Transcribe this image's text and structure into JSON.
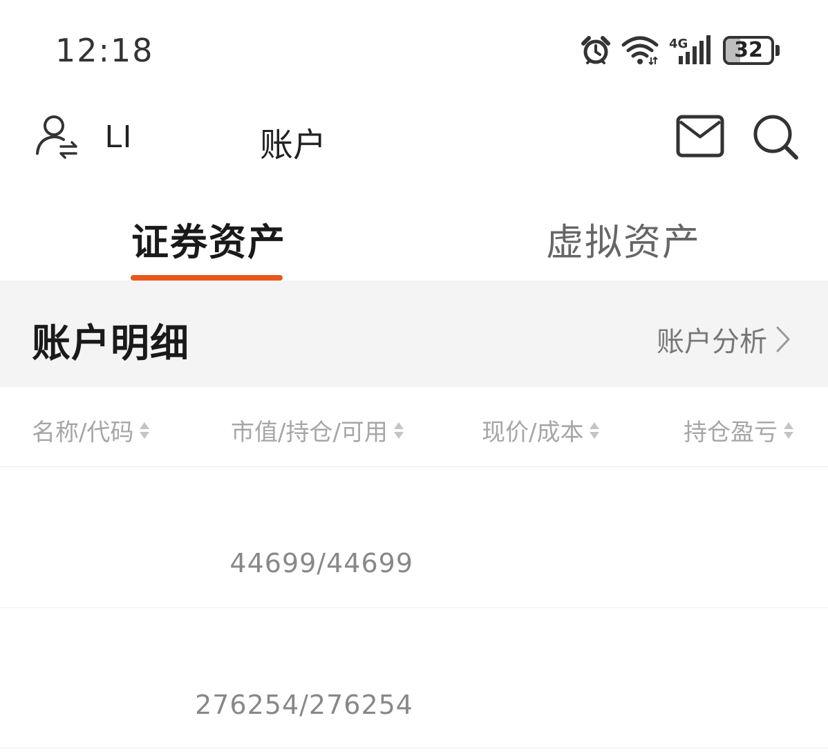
{
  "status_bar": {
    "time": "12:18",
    "network": "4G",
    "battery_level": "32",
    "icons": [
      "alarm-icon",
      "wifi-icon",
      "signal-icon",
      "battery-icon"
    ]
  },
  "header": {
    "user_name": "LI",
    "title": "账户",
    "icons": [
      "user-switch-icon",
      "mail-icon",
      "search-icon"
    ]
  },
  "tabs": [
    {
      "label": "证券资产",
      "active": true
    },
    {
      "label": "虚拟资产",
      "active": false
    }
  ],
  "section": {
    "title": "账户明细",
    "link_label": "账户分析"
  },
  "table": {
    "columns": [
      "名称/代码",
      "市值/持仓/可用",
      "现价/成本",
      "持仓盈亏"
    ],
    "rows": [
      {
        "name": "",
        "holdings": "44699/44699"
      },
      {
        "name": "",
        "holdings": "276254/276254"
      }
    ]
  },
  "colors": {
    "accent": "#e8581a",
    "section_bg": "#f4f4f4",
    "muted_text": "#a6a6a6"
  }
}
